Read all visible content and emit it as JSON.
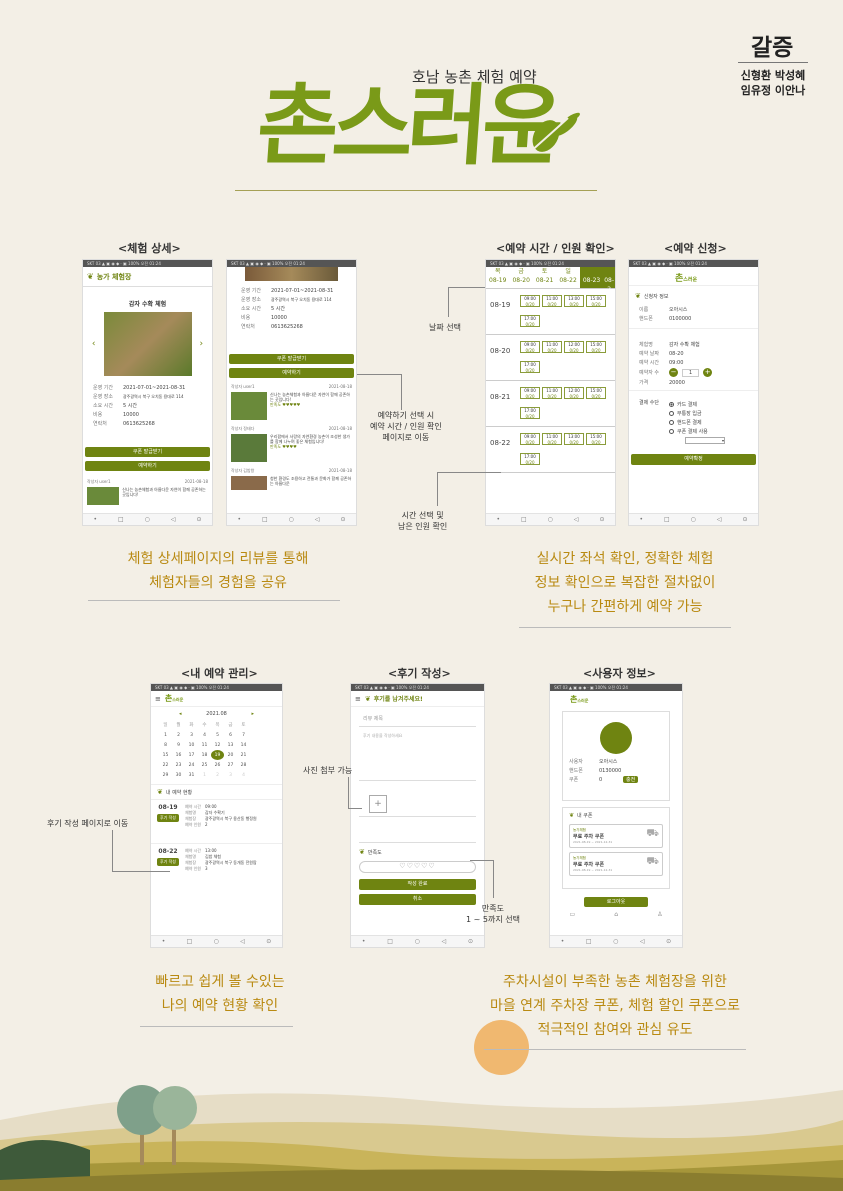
{
  "team": {
    "name": "갈증",
    "members_line1": "신형환 박성혜",
    "members_line2": "임유정 이안나"
  },
  "brand": {
    "subtitle": "호남 농촌 체험 예약",
    "title": "촌스러운"
  },
  "sections": {
    "detail": "<체험 상세>",
    "time": "<예약 시간 / 인원 확인>",
    "apply": "<예약 신청>",
    "myres": "<내 예약 관리>",
    "review": "<후기 작성>",
    "user": "<사용자 정보>"
  },
  "captions": {
    "detail": [
      "체험 상세페이지의 리뷰를 통해",
      "체험자들의 경험을 공유"
    ],
    "time": [
      "실시간 좌석 확인, 정확한 체험",
      "정보 확인으로 복잡한 절차없이",
      "누구나 간편하게 예약 가능"
    ],
    "myres": [
      "빠르고 쉽게 볼 수있는",
      "나의 예약 현황 확인"
    ],
    "user": [
      "주차시설이 부족한 농촌 체험장을 위한",
      "마을 연계 주차장 쿠폰, 체험 할인 쿠폰으로",
      "적극적인 참여와 관심 유도"
    ]
  },
  "callouts": {
    "date_select": "날짜 선택",
    "reserve_btn": [
      "예약하기 선택 시",
      "예약 시간 / 인원 확인",
      "페이지로 이동"
    ],
    "time_select": [
      "시간 선택 및",
      "남은 인원 확인"
    ],
    "photo": "사진 첨부 가능",
    "review_move": "후기 작성 페이지로 이동",
    "rating": [
      "만족도",
      "1 ~ 5까지 선택"
    ]
  },
  "phone_detail": {
    "status": "SKT 03 ▲ ▣ ◉ ◆ ·   ▣ 100% 오전 01:24",
    "header": "농가 체험장",
    "title": "감자 수확 체험",
    "info": [
      [
        "운영 기간",
        "2021-07-01~2021-08-31"
      ],
      [
        "운영 장소",
        "광주광역시 북구 오치동 용대로 114"
      ],
      [
        "소요 시간",
        "5 시간"
      ],
      [
        "비용",
        "10000"
      ],
      [
        "연락처",
        "0613625268"
      ]
    ],
    "coupon_btn": "쿠폰 발급받기",
    "reserve_btn": "예약하기",
    "review_author": "작성자 user1",
    "review_date": "2021-08-18",
    "review_text": "신나는 농촌체험과 아름다운 자연이 함께 공존하는 곳입니다!"
  },
  "phone_detail2": {
    "info": [
      [
        "운영 기간",
        "2021-07-01~2021-08-31"
      ],
      [
        "운영 장소",
        "광주광역시 북구 오치동 용대로 114"
      ],
      [
        "소요 시간",
        "5 시간"
      ],
      [
        "비용",
        "10000"
      ],
      [
        "연락처",
        "0613625268"
      ]
    ],
    "coupon_btn": "쿠폰 발급받기",
    "reserve_btn": "예약하기",
    "reviews": [
      {
        "author": "작성자 user1",
        "date": "2021-08-18",
        "text": "신나는 농촌체험과 아름다운 자연이 함께 공존하는 곳입니다!",
        "sat": "만족도 ♥♥♥♥♥"
      },
      {
        "author": "작성자 정태다",
        "date": "2021-08-18",
        "text": "우리팜에서 사랑의 자연환경 농촌이 조성한 생가를 함께 나누며 좋은 체험입니다!",
        "sat": "만족도 ♥♥♥♥"
      },
      {
        "author": "작성자 김밥왕",
        "date": "2021-08-18",
        "text": "청한 환경도 조용하고 전통과 문화가 함께 공존하는 아름다운",
        "sat": ""
      }
    ]
  },
  "phone_time": {
    "days": [
      "목",
      "금",
      "토",
      "일"
    ],
    "dates": [
      "08-19",
      "08-20",
      "08-21",
      "08-22",
      "08-23",
      "08-2"
    ],
    "rows": [
      {
        "date": "08-19",
        "slots": [
          [
            "09:00",
            "0/20"
          ],
          [
            "11:00",
            "0/20"
          ],
          [
            "13:00",
            "0/20"
          ],
          [
            "15:00",
            "0/20"
          ],
          [
            "17:00",
            "0/20"
          ]
        ]
      },
      {
        "date": "08-20",
        "slots": [
          [
            "09:00",
            "0/20"
          ],
          [
            "11:00",
            "0/20"
          ],
          [
            "12:00",
            "0/20"
          ],
          [
            "15:00",
            "0/20"
          ],
          [
            "17:00",
            "0/20"
          ]
        ]
      },
      {
        "date": "08-21",
        "slots": [
          [
            "09:00",
            "0/20"
          ],
          [
            "11:00",
            "0/20"
          ],
          [
            "12:00",
            "0/20"
          ],
          [
            "15:00",
            "0/20"
          ],
          [
            "17:00",
            "0/20"
          ]
        ]
      },
      {
        "date": "08-22",
        "slots": [
          [
            "09:00",
            "0/20"
          ],
          [
            "11:00",
            "0/20"
          ],
          [
            "13:00",
            "0/20"
          ],
          [
            "15:00",
            "0/20"
          ],
          [
            "17:00",
            "0/20"
          ]
        ]
      }
    ]
  },
  "phone_apply": {
    "section": "신청자 정보",
    "fields": [
      [
        "이름",
        "오아시스"
      ],
      [
        "핸드폰",
        "0100000"
      ]
    ],
    "info": [
      [
        "체험명",
        "감자 수확 체험"
      ],
      [
        "예약 날짜",
        "08-20"
      ],
      [
        "예약 시간",
        "09:00"
      ],
      [
        "예약자 수",
        "1"
      ],
      [
        "가격",
        "20000"
      ]
    ],
    "pay_label": "결제 수단",
    "pay_options": [
      "카드 결제",
      "무통장 입금",
      "핸드폰 결제",
      "쿠폰 결제 사용"
    ],
    "submit": "예약확정"
  },
  "phone_myres": {
    "month": "2021.08",
    "weekdays": [
      "일",
      "월",
      "화",
      "수",
      "목",
      "금",
      "토"
    ],
    "weeks": [
      [
        "1",
        "2",
        "3",
        "4",
        "5",
        "6",
        "7"
      ],
      [
        "8",
        "9",
        "10",
        "11",
        "12",
        "13",
        "14"
      ],
      [
        "15",
        "16",
        "17",
        "18",
        "19",
        "20",
        "21"
      ],
      [
        "22",
        "23",
        "24",
        "25",
        "26",
        "27",
        "28"
      ],
      [
        "29",
        "30",
        "31",
        "1",
        "2",
        "3",
        "4"
      ]
    ],
    "status_title": "내 예약 현황",
    "items": [
      {
        "date": "08-19",
        "badge": "후기 작성",
        "rows": [
          [
            "예약 시간",
            "09:00"
          ],
          [
            "체험명",
            "감자 수확기"
          ],
          [
            "체험장",
            "광주광역시 북구 용산동 행정원"
          ],
          [
            "예약 인원",
            "2"
          ]
        ]
      },
      {
        "date": "08-22",
        "badge": "후기 작성",
        "rows": [
          [
            "예약 시간",
            "13:00"
          ],
          [
            "체험명",
            "김밥 체험"
          ],
          [
            "체험장",
            "광주광역시 북구 동개동 전원팜"
          ],
          [
            "예약 인원",
            "3"
          ]
        ]
      }
    ]
  },
  "phone_review": {
    "header": "후기를 남겨주세요!",
    "title_ph": "리뷰 제목",
    "body_ph": "후기 내용을 작성하세요",
    "sat_label": "만족도",
    "submit": "작성 완료",
    "cancel": "취소"
  },
  "phone_user": {
    "fields": [
      [
        "사용자",
        "오아시스"
      ],
      [
        "핸드폰",
        "0130000"
      ],
      [
        "쿠폰",
        "0"
      ]
    ],
    "charge_btn": "충전",
    "coupon_title": "내 쿠폰",
    "coupons": [
      {
        "place": "농가체험",
        "name": "무료 주차 쿠폰",
        "date": "2021-08-19 ~ 2021-12-31"
      },
      {
        "place": "농가체험",
        "name": "무료 주차 쿠폰",
        "date": "2021-08-19 ~ 2021-12-31"
      }
    ],
    "logout": "로그아웃"
  },
  "colors": {
    "olive": "#6f8411",
    "caption": "#b98a12",
    "bg": "#f3efe6",
    "sun": "#f0b870"
  }
}
